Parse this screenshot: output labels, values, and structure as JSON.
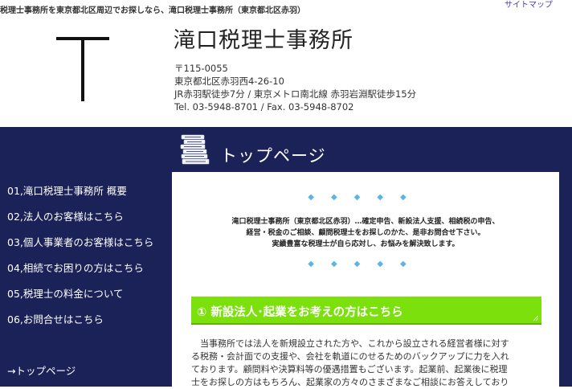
{
  "header": {
    "tagline": "税理士事務所を東京都北区周辺でお探しなら、滝口税理士事務所（東京都北区赤羽）",
    "sitemap_link": "サイトマップ",
    "office_name": "滝口税理士事務所",
    "logo_icon": "T-logo-mark",
    "address_lines": [
      "〒115-0055",
      "東京都北区赤羽西4-26-10",
      "JR赤羽駅徒歩7分 / 東京メトロ南北線 赤羽岩淵駅徒歩15分",
      "Tel. 03-5948-8701 / Fax. 03-5948-8702"
    ]
  },
  "nav": {
    "items": [
      "01,滝口税理士事務所 概要",
      "02,法人のお客様はこちら",
      "03,個人事業者のお客様はこちら",
      "04,相続でお困りの方はこちら",
      "05,税理士の料金について",
      "06,お問合せはこちら"
    ],
    "top_page_link": "→トップページ",
    "background_color": "#1a2257"
  },
  "main": {
    "page_icon": "stacked-books-icon",
    "heading": "トップページ",
    "diamond_row": "◆◆◆◆◆",
    "intro_lines": [
      "滝口税理士事務所（東京都北区赤羽）…確定申告、新設法人支援、相続税の申告、",
      "経営・税金のご相談、顧問税理士をお探しのかた、是非お問合せ下さい。",
      "実績豊富な税理士が自ら応対し、お悩みを解決致します。"
    ],
    "banner": {
      "title": "① 新設法人･起業をお考えの方はこちら",
      "color": "#7be00c"
    },
    "body_lines": [
      "　当事務所では法人を新規設立された方や、これから設立される経営者様に対す",
      "る税務・会計面での支援や、会社を軌道にのせるためのバックアップに力を入れ",
      "ております。顧問料や決算料等の優遇措置もございます。起業前、起業後に税理",
      "士をお探しの方はもちろん、起業家の方々のさまざまなご相談にお答えしており"
    ]
  }
}
